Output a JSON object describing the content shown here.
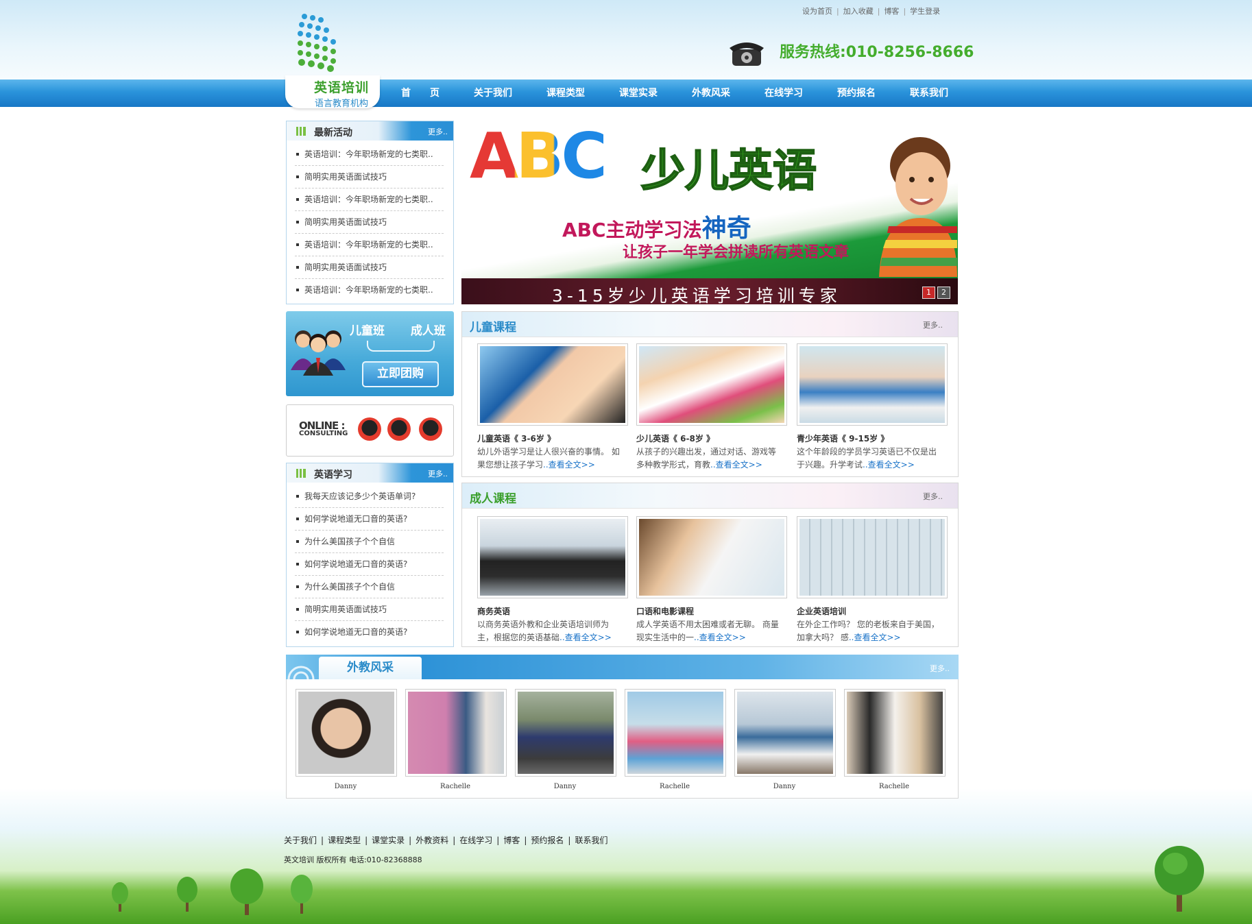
{
  "top_links": [
    "设为首页",
    "加入收藏",
    "博客",
    "学生登录"
  ],
  "logo": {
    "name": "英语培训",
    "sub": "语言教育机构"
  },
  "hotline": "服务热线:010-8256-8666",
  "nav": [
    "首　　页",
    "关于我们",
    "课程类型",
    "课堂实录",
    "外教风采",
    "在线学习",
    "预约报名",
    "联系我们"
  ],
  "latest": {
    "title": "最新活动",
    "more": "更多..",
    "items": [
      "英语培训：今年职场新宠的七类职..",
      "简明实用英语面试技巧",
      "英语培训：今年职场新宠的七类职..",
      "简明实用英语面试技巧",
      "英语培训：今年职场新宠的七类职..",
      "简明实用英语面试技巧",
      "英语培训：今年职场新宠的七类职.."
    ]
  },
  "promo": {
    "kids": "儿童班",
    "adults": "成人班",
    "button": "立即团购"
  },
  "online": {
    "line1": "ONLINE :",
    "line2": "CONSULTING"
  },
  "study": {
    "title": "英语学习",
    "more": "更多..",
    "items": [
      "我每天应该记多少个英语单词?",
      "如何学说地道无口音的英语?",
      "为什么美国孩子个个自信",
      "如何学说地道无口音的英语?",
      "为什么美国孩子个个自信",
      "简明实用英语面试技巧",
      "如何学说地道无口音的英语?"
    ]
  },
  "banner": {
    "abc": "ABC",
    "title": "少儿英语",
    "line1_a": "ABC主动学习法",
    "line1_b": "神奇",
    "line2": "让孩子一年学会拼读所有英语文章",
    "tag": "3-15岁少儿英语学习培训专家",
    "pages": [
      "1",
      "2"
    ]
  },
  "kids_courses": {
    "title": "儿童课程",
    "more": "更多..",
    "items": [
      {
        "title": "儿童英语《 3-6岁 》",
        "desc": "幼儿外语学习是让人很兴奋的事情。 如果您想让孩子学习",
        "link": "..查看全文>>"
      },
      {
        "title": "少儿英语《 6-8岁 》",
        "desc": "从孩子的兴趣出发，通过对话、游戏等多种教学形式，育教",
        "link": "..查看全文>>"
      },
      {
        "title": "青少年英语《 9-15岁 》",
        "desc": "这个年龄段的学员学习英语已不仅是出于兴趣。升学考试",
        "link": "..查看全文>>"
      }
    ]
  },
  "adult_courses": {
    "title": "成人课程",
    "more": "更多..",
    "items": [
      {
        "title": "商务英语",
        "desc": "以商务英语外教和企业英语培训师为主，根据您的英语基础",
        "link": "..查看全文>>"
      },
      {
        "title": "口语和电影课程",
        "desc": "成人学英语不用太困难或者无聊。 商量现实生活中的一",
        "link": "..查看全文>>"
      },
      {
        "title": "企业英语培训",
        "desc": "在外企工作吗？ 您的老板来自于美国，加拿大吗？ 感",
        "link": "..查看全文>>"
      }
    ]
  },
  "teachers": {
    "title": "外教风采",
    "more": "更多..",
    "items": [
      "Danny",
      "Rachelle",
      "Danny",
      "Rachelle",
      "Danny",
      "Rachelle"
    ]
  },
  "footer": {
    "links": [
      "关于我们",
      "课程类型",
      "课堂实录",
      "外教资料",
      "在线学习",
      "博客",
      "预约报名",
      "联系我们"
    ],
    "copyright": "英文培训  版权所有  电话:010-82368888"
  },
  "colors": {
    "primary_blue": "#2a93db",
    "green": "#44ad2d",
    "link_blue": "#1a73c8"
  }
}
